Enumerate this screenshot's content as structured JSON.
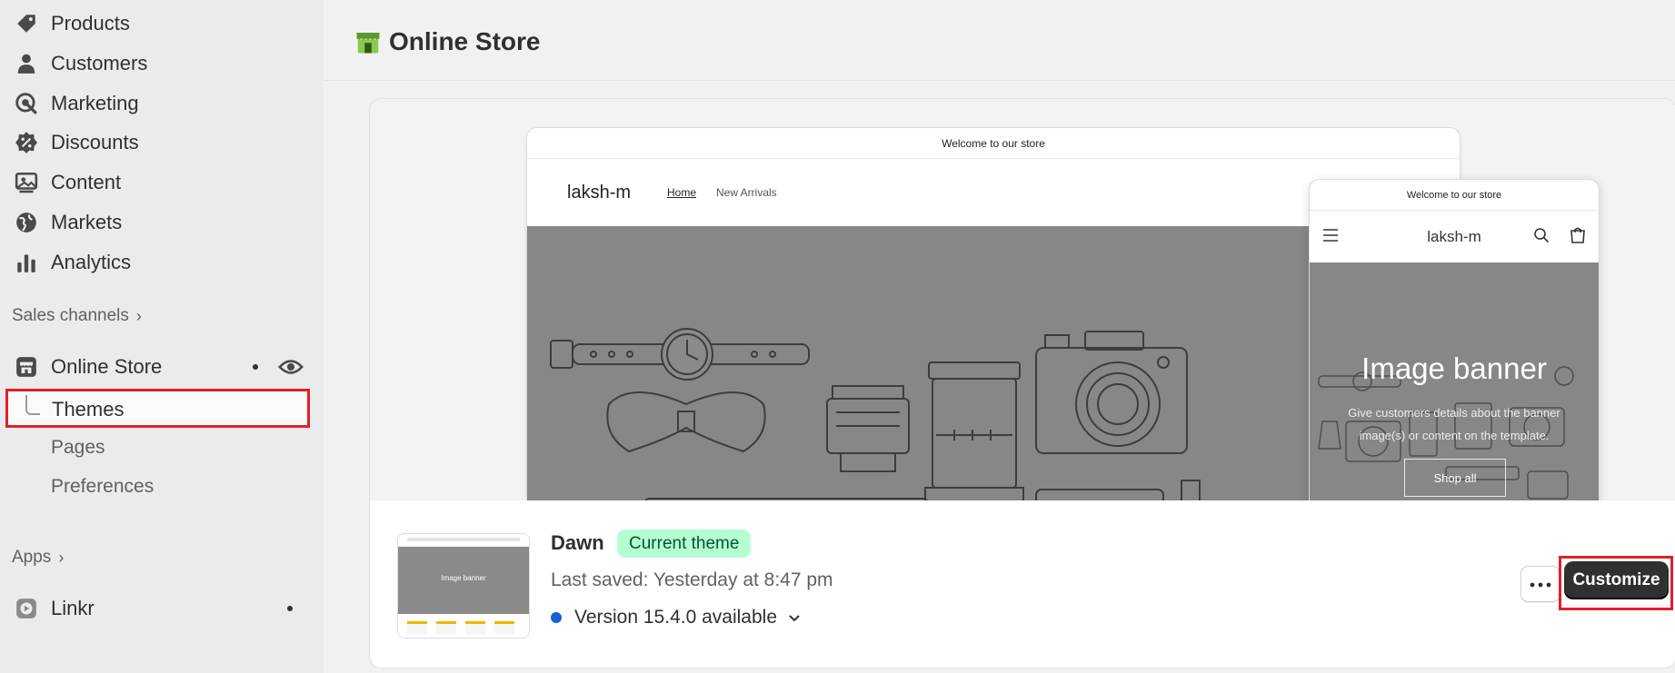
{
  "sidebar": {
    "items": [
      {
        "label": "Products",
        "icon": "tag-icon"
      },
      {
        "label": "Customers",
        "icon": "person-icon"
      },
      {
        "label": "Marketing",
        "icon": "target-icon"
      },
      {
        "label": "Discounts",
        "icon": "discount-icon"
      },
      {
        "label": "Content",
        "icon": "image-icon"
      },
      {
        "label": "Markets",
        "icon": "globe-icon"
      },
      {
        "label": "Analytics",
        "icon": "bar-chart-icon"
      }
    ],
    "sales_channels_label": "Sales channels",
    "online_store_label": "Online Store",
    "themes_label": "Themes",
    "pages_label": "Pages",
    "preferences_label": "Preferences",
    "apps_label": "Apps",
    "linkr_label": "Linkr"
  },
  "header": {
    "title": "Online Store"
  },
  "preview": {
    "desktop_announcement": "Welcome to our store",
    "desktop_logo": "laksh-m",
    "desktop_nav": [
      "Home",
      "New Arrivals"
    ],
    "mobile_announcement": "Welcome to our store",
    "mobile_logo": "laksh-m",
    "hero_title": "Image banner",
    "hero_text": "Give customers details about the banner image(s) or content on the template.",
    "hero_button": "Shop all",
    "thumb_hero": "Image banner"
  },
  "theme": {
    "name": "Dawn",
    "badge": "Current theme",
    "last_saved": "Last saved: Yesterday at 8:47 pm",
    "version": "Version 15.4.0 available",
    "customize_label": "Customize"
  },
  "colors": {
    "badge_bg": "#b4fed2",
    "badge_text": "#0c5132",
    "highlight": "#e0202b",
    "version_dot": "#1a5fd6",
    "primary_button": "#303030"
  }
}
